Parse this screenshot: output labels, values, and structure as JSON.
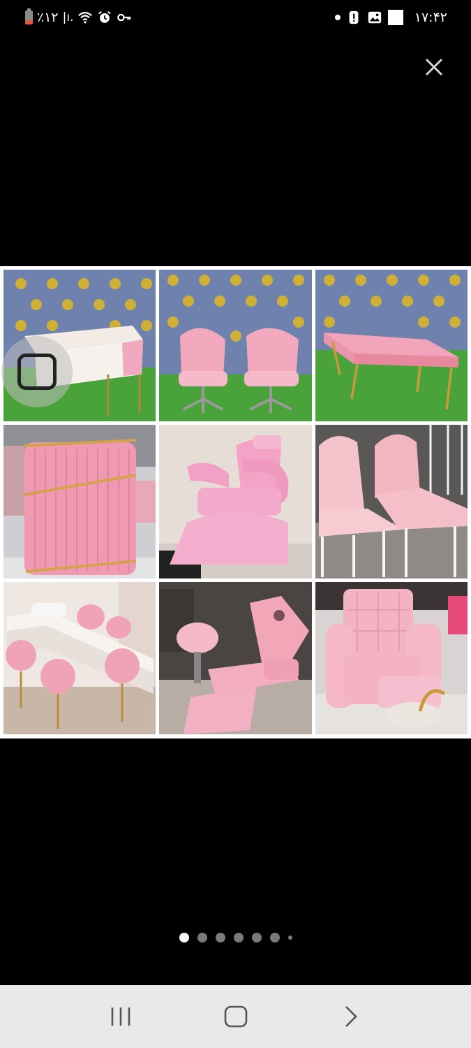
{
  "status_bar": {
    "battery_text": "٪۱۲",
    "signal_text": "|ı.",
    "time": "۱۷:۴۲",
    "icons_left": [
      "battery-icon",
      "signal-icon",
      "wifi-icon",
      "alarm-icon",
      "vpn-key-icon"
    ],
    "icons_right": [
      "notification-dot-icon",
      "alert-icon",
      "gallery-icon",
      "white-square-icon"
    ]
  },
  "viewer": {
    "close_icon": "close-icon",
    "image_tiles": [
      {
        "subject": "manicure-table"
      },
      {
        "subject": "pink-salon-chairs"
      },
      {
        "subject": "pink-tufted-bench"
      },
      {
        "subject": "reception-counter"
      },
      {
        "subject": "shampoo-chair"
      },
      {
        "subject": "massage-beds"
      },
      {
        "subject": "nail-bar-table"
      },
      {
        "subject": "facial-bed-with-stool"
      },
      {
        "subject": "pedicure-chair"
      }
    ],
    "accent_pink": "#f4b6c8",
    "wall_blue": "#6f82ad",
    "grass_green": "#4aa23a"
  },
  "pagination": {
    "total_visible": 7,
    "active_index": 0
  },
  "nav_bar": {
    "recents_icon": "recents-icon",
    "home_icon": "home-icon",
    "back_icon": "back-icon"
  }
}
